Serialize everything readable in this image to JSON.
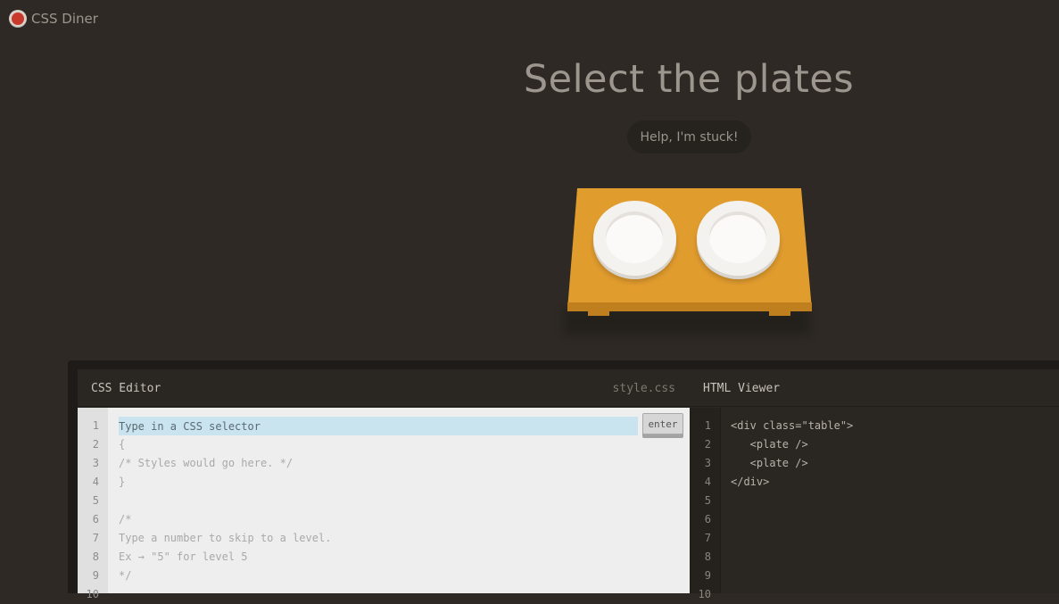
{
  "app": {
    "title": "CSS Diner"
  },
  "level": {
    "instruction": "Select the plates",
    "help_label": "Help, I'm stuck!"
  },
  "css_editor": {
    "title": "CSS Editor",
    "filename": "style.css",
    "placeholder": "Type in a CSS selector",
    "enter_label": "enter",
    "line_numbers": [
      "1",
      "2",
      "3",
      "4",
      "5",
      "6",
      "7",
      "8",
      "9",
      "10"
    ],
    "lines": [
      "",
      "{",
      "/* Styles would go here. */",
      "}",
      "",
      "/*",
      "Type a number to skip to a level.",
      "Ex → \"5\" for level 5",
      "*/",
      ""
    ]
  },
  "html_viewer": {
    "title": "HTML Viewer",
    "line_numbers": [
      "1",
      "2",
      "3",
      "4",
      "5",
      "6",
      "7",
      "8",
      "9",
      "10"
    ],
    "lines": [
      "<div class=\"table\">",
      "   <plate />",
      "   <plate />",
      "</div>",
      "",
      "",
      "",
      "",
      "",
      ""
    ]
  },
  "colors": {
    "background": "#2e2924",
    "table": "#e19c2e",
    "editor_bg": "#eeeeee",
    "input_highlight": "#c9e3ef"
  }
}
